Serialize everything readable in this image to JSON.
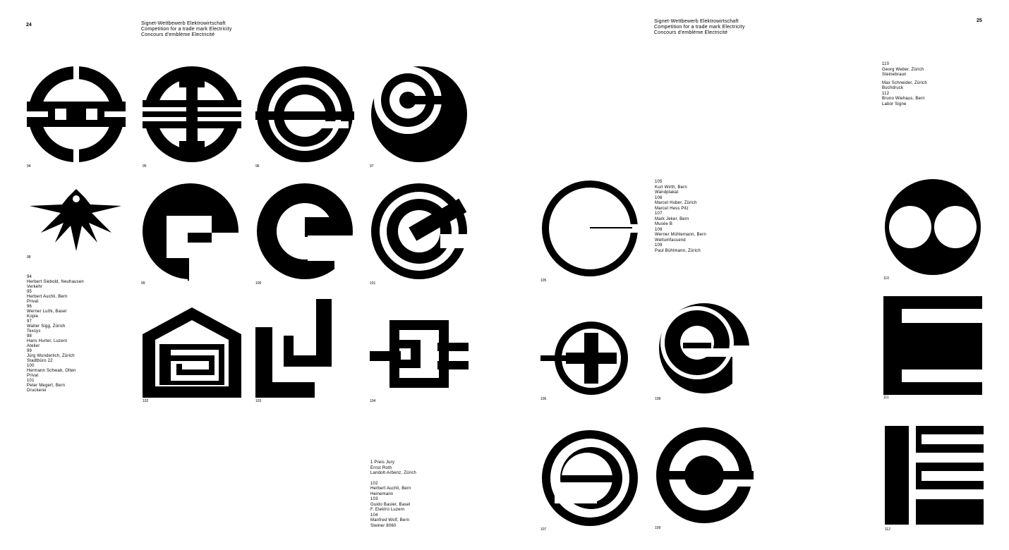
{
  "left_page": {
    "page_number": "24",
    "header": [
      "Signet-Wettbewerb Elektrowirtschaft",
      "Competition for a trade mark Electricity",
      "Concours d'emblème Electricité"
    ],
    "captions": [
      "94",
      "95",
      "96",
      "97",
      "98",
      "99",
      "100",
      "101",
      "102",
      "103",
      "104"
    ],
    "credits": [
      "94",
      "Herbert Siebold, Neuhausen",
      "Verkehr",
      "95",
      "Herbert Auchli, Bern",
      "Privat",
      "96",
      "Werner Luthi, Basel",
      "Kopie",
      "97",
      "Walter Sigg, Zürich",
      "Texsys",
      "98",
      "Hans Hurter, Luzern",
      "Atelier",
      "99",
      "Jürg Wunderlich, Zürich",
      "Stadtbüro 22",
      "100",
      "Hermann Schwab, Olten",
      "Privat",
      "101",
      "Peter Megert, Bern",
      "Druckerei"
    ],
    "credits_bottom": [
      "1 Preis Jury",
      "Ernst Roth",
      "Landolt-Arbenz, Zürich",
      "",
      "102",
      "Herbert Auchli, Bern",
      "Heinemann",
      "103",
      "Guido Basler, Basel",
      "F. Elektro Luzern",
      "104",
      "Manfred Wolf, Bern",
      "Steiner 8060"
    ]
  },
  "right_page": {
    "page_number": "25",
    "header": [
      "Signet-Wettbewerb Elektrowirtschaft",
      "Competition for a trade mark Electricity",
      "Concours d'emblème Electricité"
    ],
    "captions": [
      "105",
      "106",
      "107",
      "108",
      "109",
      "110",
      "111",
      "112"
    ],
    "credits_top": [
      "110",
      "Georg Weber, Zürich",
      "Steinebraun",
      "",
      "Max Schneider, Zürich",
      "Buchdruck",
      "112",
      "Bruno Wiehaus, Bern",
      "Labor Signe"
    ],
    "credits_mid": [
      "105",
      "Kurt Wirth, Bern",
      "Wandplakat",
      "106",
      "Marcel Huber, Zürich",
      "Marcel Hess Pilz",
      "107",
      "Mark Jeker, Bern",
      "Musée B",
      "108",
      "Werner Mühlemann, Bern",
      "Weltumfassend",
      "109",
      "Paul Bühlmann, Zürich",
      "Weltumfassend"
    ]
  }
}
